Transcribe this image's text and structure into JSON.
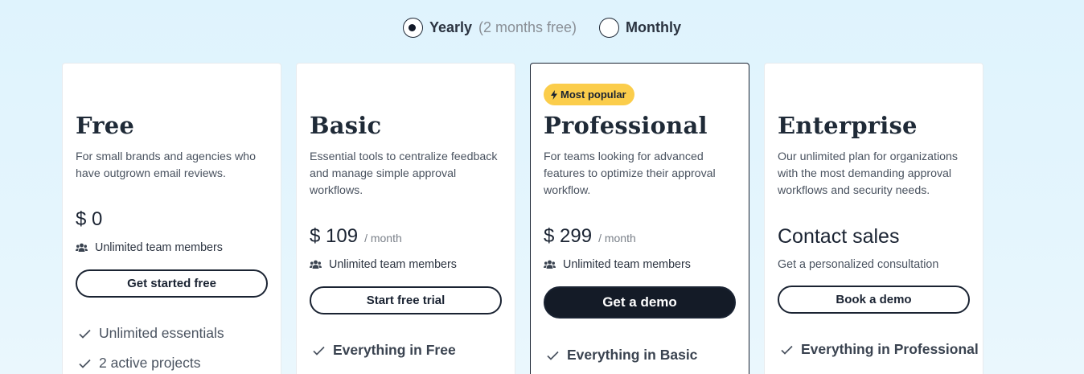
{
  "billing": {
    "yearly_label": "Yearly",
    "yearly_note": "(2 months free)",
    "monthly_label": "Monthly",
    "selected": "Yearly"
  },
  "plans": [
    {
      "name": "Free",
      "description": "For small brands and agencies who have outgrown email reviews.",
      "price": "$ 0",
      "period": "",
      "members": "Unlimited team members",
      "cta": "Get started free",
      "features": [
        "Unlimited essentials",
        "2 active projects"
      ]
    },
    {
      "name": "Basic",
      "description": "Essential tools to centralize feedback and manage simple approval workflows.",
      "price": "$ 109",
      "period": "/ month",
      "members": "Unlimited team members",
      "cta": "Start free trial",
      "features": [
        "Everything in Free"
      ]
    },
    {
      "badge": "Most popular",
      "name": "Professional",
      "description": "For teams looking for advanced features to optimize their approval workflow.",
      "price": "$ 299",
      "period": "/ month",
      "members": "Unlimited team members",
      "cta": "Get a demo",
      "features": [
        "Everything in Basic"
      ]
    },
    {
      "name": "Enterprise",
      "description": "Our unlimited plan for organizations with the most demanding approval workflows and security needs.",
      "contact_title": "Contact sales",
      "contact_subtitle": "Get a personalized consultation",
      "cta": "Book a demo",
      "features": [
        "Everything in Professional"
      ]
    }
  ],
  "colors": {
    "background": "#dff3fd",
    "badge": "#fbcd4b",
    "primary_dark": "#141b27",
    "text": "#1a2332"
  },
  "icons": {
    "members": "users-icon",
    "feature": "check-icon",
    "badge": "lightning-icon"
  }
}
